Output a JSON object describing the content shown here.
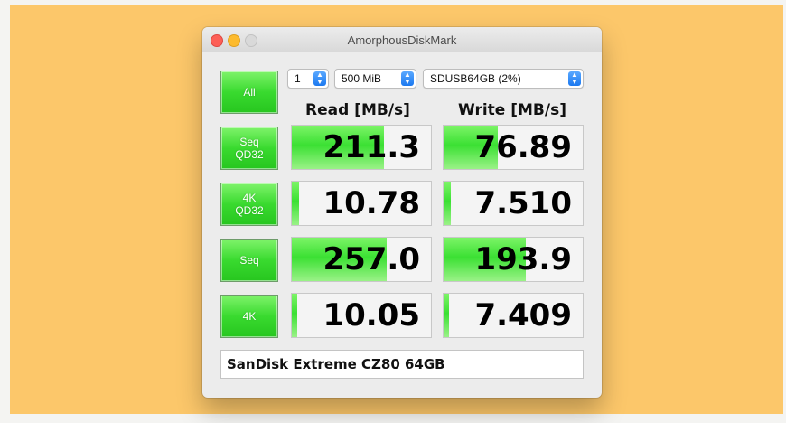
{
  "window": {
    "title": "AmorphousDiskMark"
  },
  "controls": {
    "all_label": "All",
    "count": "1",
    "size": "500 MiB",
    "drive": "SDUSB64GB (2%)"
  },
  "columns": {
    "read": "Read [MB/s]",
    "write": "Write [MB/s]"
  },
  "tests": [
    {
      "label": "Seq\nQD32",
      "read": "211.3",
      "write": "76.89",
      "read_level": 0.66,
      "write_level": 0.39
    },
    {
      "label": "4K\nQD32",
      "read": "10.78",
      "write": "7.510",
      "read_level": 0.05,
      "write_level": 0.05
    },
    {
      "label": "Seq",
      "read": "257.0",
      "write": "193.9",
      "read_level": 0.68,
      "write_level": 0.59
    },
    {
      "label": "4K",
      "read": "10.05",
      "write": "7.409",
      "read_level": 0.04,
      "write_level": 0.04
    }
  ],
  "comment": "SanDisk Extreme CZ80 64GB",
  "colors": {
    "backdrop": "#fcc76a",
    "bar_green": "#3be033",
    "button_green": "#39da2f"
  }
}
